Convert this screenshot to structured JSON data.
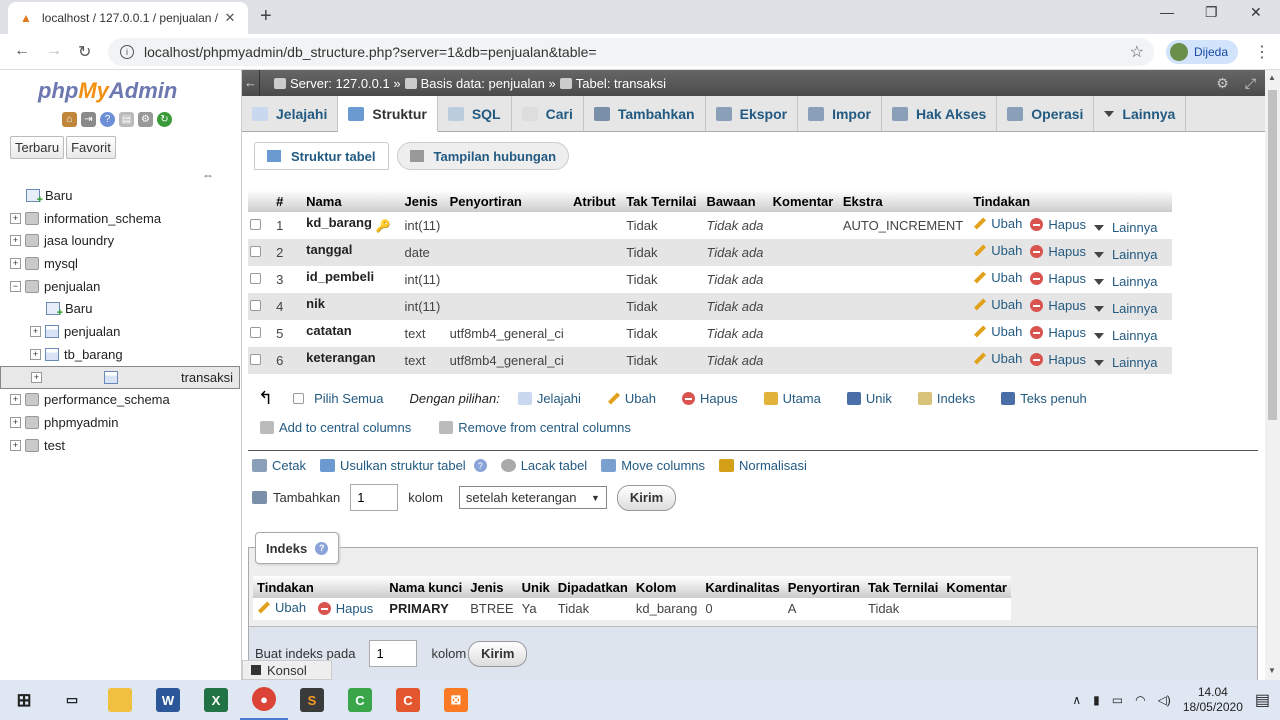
{
  "browser": {
    "tab_title": "localhost / 127.0.0.1 / penjualan /",
    "url": "localhost/phpmyadmin/db_structure.php?server=1&db=penjualan&table=",
    "profile_name": "Dijeda"
  },
  "sidebar": {
    "logo": {
      "php": "php",
      "my": "My",
      "admin": "Admin"
    },
    "tabs": [
      "Terbaru",
      "Favorit"
    ],
    "tree": [
      {
        "label": "Baru",
        "type": "new",
        "level": 0
      },
      {
        "label": "information_schema",
        "type": "db",
        "level": 0
      },
      {
        "label": "jasa loundry",
        "type": "db",
        "level": 0
      },
      {
        "label": "mysql",
        "type": "db",
        "level": 0
      },
      {
        "label": "penjualan",
        "type": "db",
        "level": 0,
        "expanded": true
      },
      {
        "label": "Baru",
        "type": "new",
        "level": 1
      },
      {
        "label": "penjualan",
        "type": "table",
        "level": 1
      },
      {
        "label": "tb_barang",
        "type": "table",
        "level": 1
      },
      {
        "label": "transaksi",
        "type": "table",
        "level": 1,
        "selected": true
      },
      {
        "label": "performance_schema",
        "type": "db",
        "level": 0
      },
      {
        "label": "phpmyadmin",
        "type": "db",
        "level": 0
      },
      {
        "label": "test",
        "type": "db",
        "level": 0
      }
    ]
  },
  "breadcrumb": {
    "server": "Server: 127.0.0.1 »",
    "database": "Basis data: penjualan »",
    "table": "Tabel: transaksi"
  },
  "topmenu": [
    "Jelajahi",
    "Struktur",
    "SQL",
    "Cari",
    "Tambahkan",
    "Ekspor",
    "Impor",
    "Hak Akses",
    "Operasi",
    "Lainnya"
  ],
  "subtabs": [
    "Struktur tabel",
    "Tampilan hubungan"
  ],
  "structure": {
    "headers": [
      "#",
      "Nama",
      "Jenis",
      "Penyortiran",
      "Atribut",
      "Tak Ternilai",
      "Bawaan",
      "Komentar",
      "Ekstra",
      "Tindakan"
    ],
    "rows": [
      {
        "num": "1",
        "name": "kd_barang",
        "type": "int(11)",
        "collation": "",
        "attr": "",
        "null": "Tidak",
        "default": "Tidak ada",
        "comment": "",
        "extra": "AUTO_INCREMENT",
        "key": true
      },
      {
        "num": "2",
        "name": "tanggal",
        "type": "date",
        "collation": "",
        "attr": "",
        "null": "Tidak",
        "default": "Tidak ada",
        "comment": "",
        "extra": ""
      },
      {
        "num": "3",
        "name": "id_pembeli",
        "type": "int(11)",
        "collation": "",
        "attr": "",
        "null": "Tidak",
        "default": "Tidak ada",
        "comment": "",
        "extra": ""
      },
      {
        "num": "4",
        "name": "nik",
        "type": "int(11)",
        "collation": "",
        "attr": "",
        "null": "Tidak",
        "default": "Tidak ada",
        "comment": "",
        "extra": ""
      },
      {
        "num": "5",
        "name": "catatan",
        "type": "text",
        "collation": "utf8mb4_general_ci",
        "attr": "",
        "null": "Tidak",
        "default": "Tidak ada",
        "comment": "",
        "extra": ""
      },
      {
        "num": "6",
        "name": "keterangan",
        "type": "text",
        "collation": "utf8mb4_general_ci",
        "attr": "",
        "null": "Tidak",
        "default": "Tidak ada",
        "comment": "",
        "extra": ""
      }
    ],
    "actions": {
      "edit": "Ubah",
      "delete": "Hapus",
      "more": "Lainnya"
    }
  },
  "bulk": {
    "select_all": "Pilih Semua",
    "with_selected": "Dengan pilihan:",
    "items": [
      "Jelajahi",
      "Ubah",
      "Hapus",
      "Utama",
      "Unik",
      "Indeks",
      "Teks penuh"
    ],
    "central_add": "Add to central columns",
    "central_remove": "Remove from central columns"
  },
  "tools": {
    "print": "Cetak",
    "propose": "Usulkan struktur tabel",
    "track": "Lacak tabel",
    "move": "Move columns",
    "normalize": "Normalisasi"
  },
  "add_column": {
    "label": "Tambahkan",
    "count": "1",
    "unit": "kolom",
    "position": "setelah keterangan",
    "submit": "Kirim"
  },
  "indexes": {
    "title": "Indeks",
    "headers": [
      "Tindakan",
      "Nama kunci",
      "Jenis",
      "Unik",
      "Dipadatkan",
      "Kolom",
      "Kardinalitas",
      "Penyortiran",
      "Tak Ternilai",
      "Komentar"
    ],
    "row": {
      "edit": "Ubah",
      "delete": "Hapus",
      "keyname": "PRIMARY",
      "type": "BTREE",
      "unique": "Ya",
      "packed": "Tidak",
      "column": "kd_barang",
      "cardinality": "0",
      "collation": "A",
      "null": "Tidak",
      "comment": ""
    },
    "create_label": "Buat indeks pada",
    "create_count": "1",
    "create_unit": "kolom",
    "create_submit": "Kirim"
  },
  "console": "Konsol",
  "taskbar": {
    "time": "14.04",
    "date": "18/05/2020"
  }
}
